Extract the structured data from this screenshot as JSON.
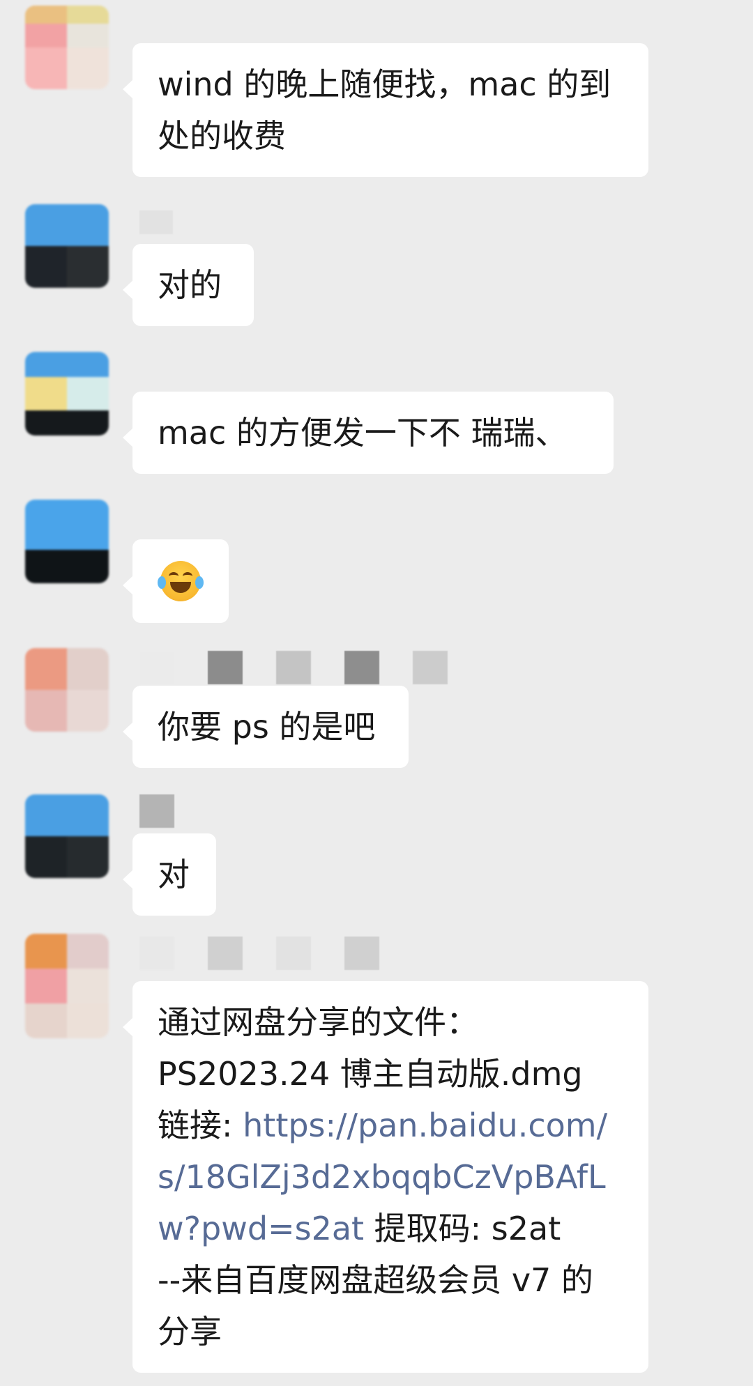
{
  "messages": [
    {
      "text": "wind 的晚上随便找，mac 的到处的收费"
    },
    {
      "text": "对的"
    },
    {
      "text": "mac 的方便发一下不  瑞瑞、"
    },
    {
      "emoji": "tears-of-joy-emoji"
    },
    {
      "text": "你要 ps 的是吧"
    },
    {
      "text": "对"
    },
    {
      "line1": "通过网盘分享的文件：",
      "line2": "PS2023.24 博主自动版.dmg",
      "link_label": "链接: ",
      "link_url": "https://pan.baidu.com/s/18GlZj3d2xbqqbCzVpBAfLw?pwd=s2at",
      "code_text": " 提取码: s2at",
      "footer": "--来自百度网盘超级会员 v7 的分享"
    }
  ],
  "colors": {
    "background": "#ececec",
    "bubble": "#ffffff",
    "link": "#576b95"
  }
}
